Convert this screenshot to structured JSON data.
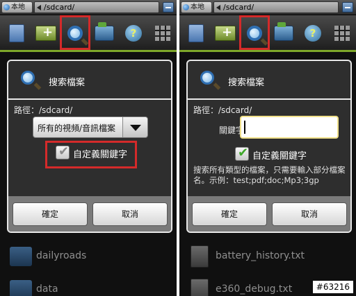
{
  "status_bar": {
    "home_label": "本地",
    "path": "/sdcard/"
  },
  "toolbar": {
    "tools": [
      "documents",
      "new-folder",
      "search",
      "folder-up",
      "help",
      "grid-menu"
    ]
  },
  "left_dialog": {
    "title": "搜索檔案",
    "path_label": "路徑：/sdcard/",
    "filter_selected": "所有的視頻/音訊檔案",
    "custom_keyword_label": "自定義關鍵字",
    "custom_keyword_checked": false,
    "ok_label": "確定",
    "cancel_label": "取消"
  },
  "right_dialog": {
    "title": "搜索檔案",
    "path_label": "路徑：/sdcard/",
    "keyword_label": "關鍵字：",
    "keyword_value": "",
    "custom_keyword_label": "自定義關鍵字",
    "custom_keyword_checked": true,
    "hint": "搜索所有類型的檔案，只需要輸入部分檔案名。示例：test;pdf;doc;Mp3;3gp",
    "ok_label": "確定",
    "cancel_label": "取消"
  },
  "left_files": [
    {
      "name": "dailyroads",
      "type": "folder"
    },
    {
      "name": "data",
      "type": "folder"
    }
  ],
  "right_files": [
    {
      "name": "battery_history.txt",
      "type": "file"
    },
    {
      "name": "e360_debug.txt",
      "type": "file"
    }
  ],
  "watermark": "#63216",
  "colors": {
    "highlight": "#d42a2a",
    "accent_green": "#7ea82a",
    "check_green": "#3fa82a",
    "check_grey": "#8a8a8a"
  }
}
